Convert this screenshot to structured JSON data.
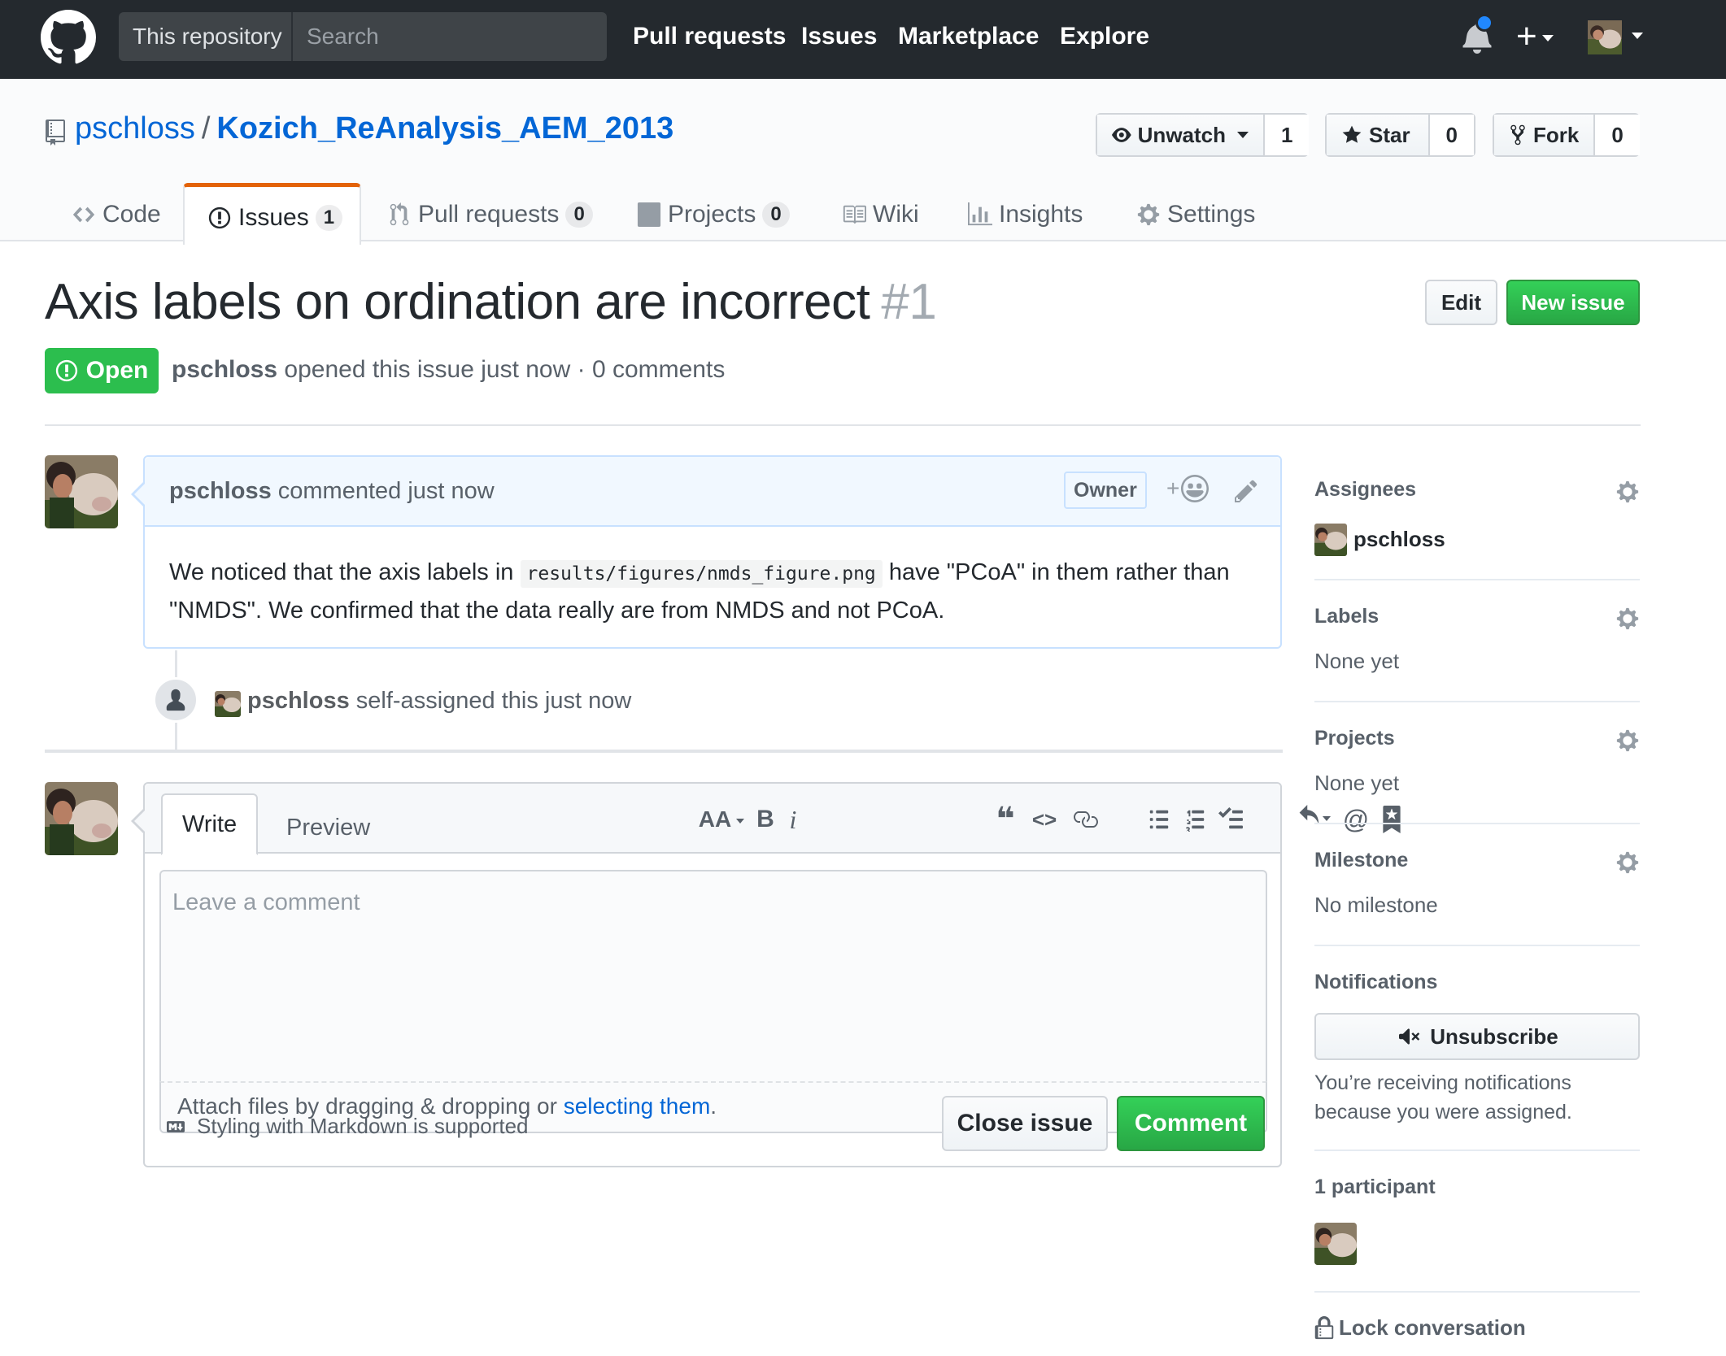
{
  "header": {
    "search_scope": "This repository",
    "search_placeholder": "Search",
    "nav": [
      "Pull requests",
      "Issues",
      "Marketplace",
      "Explore"
    ],
    "plus_label": "+"
  },
  "repo": {
    "owner": "pschloss",
    "separator": "/",
    "name": "Kozich_ReAnalysis_AEM_2013",
    "watch_label": "Unwatch",
    "watch_count": "1",
    "star_label": "Star",
    "star_count": "0",
    "fork_label": "Fork",
    "fork_count": "0",
    "tabs": [
      {
        "label": "Code",
        "icon": "code-icon"
      },
      {
        "label": "Issues",
        "count": "1",
        "icon": "issue-opened-icon"
      },
      {
        "label": "Pull requests",
        "count": "0",
        "icon": "git-pull-request-icon"
      },
      {
        "label": "Projects",
        "count": "0",
        "icon": "project-icon"
      },
      {
        "label": "Wiki",
        "icon": "book-icon"
      },
      {
        "label": "Insights",
        "icon": "graph-icon"
      },
      {
        "label": "Settings",
        "icon": "gear-icon"
      }
    ]
  },
  "issue": {
    "title": "Axis labels on ordination are incorrect",
    "number": "#1",
    "edit_label": "Edit",
    "new_issue_label": "New issue",
    "state": "Open",
    "author": "pschloss",
    "meta_rest": " opened this issue just now · 0 comments"
  },
  "comment": {
    "author": "pschloss",
    "action": " commented just now",
    "owner_label": "Owner",
    "reaction_plus": "+",
    "body_part1": "We noticed that the axis labels in ",
    "body_code": "results/figures/nmds_figure.png",
    "body_part2": " have \"PCoA\" in them rather than \"NMDS\". We confirmed that the data really are from NMDS and not PCoA."
  },
  "event": {
    "author": "pschloss",
    "text": " self-assigned this just now"
  },
  "form": {
    "write_tab": "Write",
    "preview_tab": "Preview",
    "placeholder": "Leave a comment",
    "attach_text": "Attach files by dragging & dropping or ",
    "attach_link": "selecting them",
    "attach_end": ".",
    "markdown_note": "Styling with Markdown is supported",
    "close_label": "Close issue",
    "comment_label": "Comment",
    "toolbar": {
      "header": "AA",
      "bold": "B",
      "italic": "i",
      "quote": "❝",
      "code": "<>",
      "mention": "@"
    }
  },
  "sidebar": {
    "assignees_title": "Assignees",
    "assignee": "pschloss",
    "labels_title": "Labels",
    "labels_value": "None yet",
    "projects_title": "Projects",
    "projects_value": "None yet",
    "milestone_title": "Milestone",
    "milestone_value": "No milestone",
    "notifications_title": "Notifications",
    "unsubscribe_label": "Unsubscribe",
    "notif_reason": "You’re receiving notifications because you were assigned.",
    "participants_title": "1 participant",
    "lock_label": "Lock conversation"
  },
  "colors": {
    "header_bg": "#24292e",
    "link": "#0366d6",
    "open_green": "#2cbe4e",
    "primary_button": "#28a745",
    "tab_accent": "#e36209"
  }
}
